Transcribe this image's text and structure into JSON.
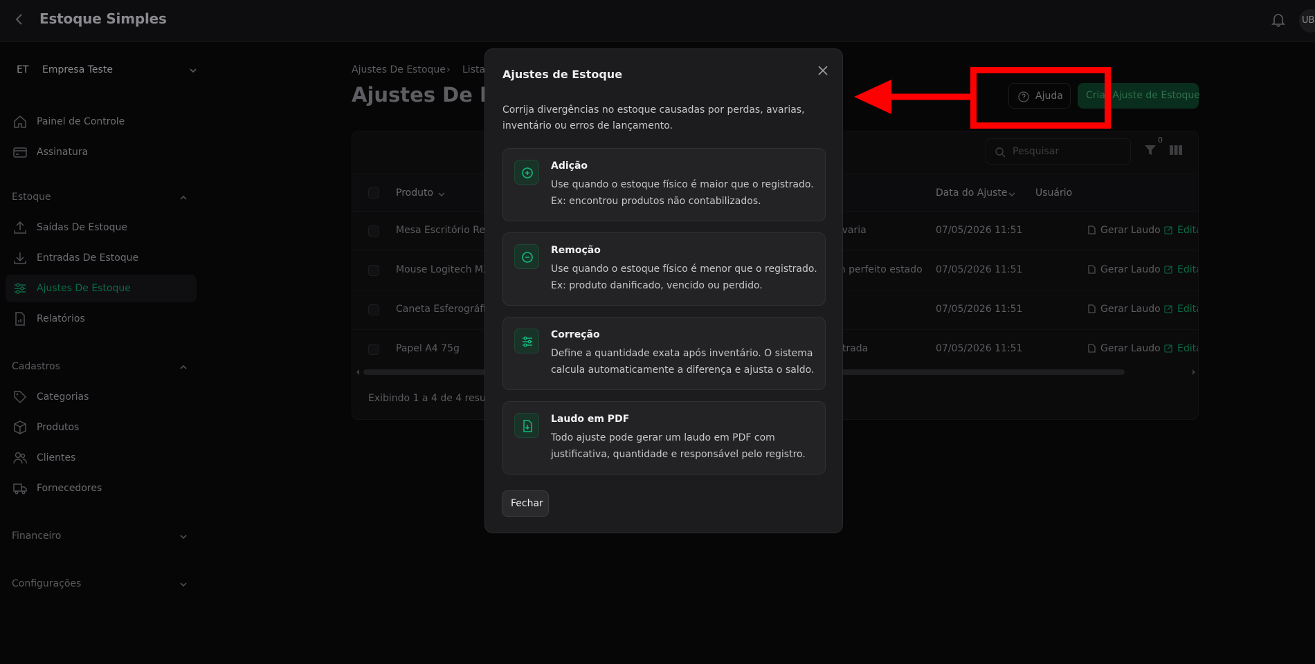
{
  "app": {
    "title": "Estoque Simples",
    "avatar_initials": "UB"
  },
  "sidebar": {
    "company": {
      "abbr": "ET",
      "name": "Empresa Teste"
    },
    "top_items": [
      {
        "label": "Painel de Controle",
        "icon": "home-icon"
      },
      {
        "label": "Assinatura",
        "icon": "credit-card-icon"
      }
    ],
    "sections": [
      {
        "title": "Estoque",
        "expanded": true
      },
      {
        "title": "Cadastros",
        "expanded": true
      },
      {
        "title": "Financeiro",
        "expanded": false
      },
      {
        "title": "Configurações",
        "expanded": false
      }
    ],
    "estoque_items": [
      {
        "label": "Saídas De Estoque",
        "icon": "upload-icon"
      },
      {
        "label": "Entradas De Estoque",
        "icon": "download-icon"
      },
      {
        "label": "Ajustes De Estoque",
        "icon": "sliders-icon",
        "active": true
      },
      {
        "label": "Relatórios",
        "icon": "report-icon"
      }
    ],
    "cadastros_items": [
      {
        "label": "Categorias",
        "icon": "tag-icon"
      },
      {
        "label": "Produtos",
        "icon": "box-icon"
      },
      {
        "label": "Clientes",
        "icon": "users-icon"
      },
      {
        "label": "Fornecedores",
        "icon": "truck-icon"
      }
    ]
  },
  "main": {
    "breadcrumb": [
      "Ajustes De Estoque",
      "Lista"
    ],
    "page_title": "Ajustes De Estoque",
    "help_label": "Ajuda",
    "create_label": "Criar Ajuste de Estoque",
    "search_placeholder": "Pesquisar",
    "filter_count": "0",
    "columns": {
      "produto": "Produto",
      "data": "Data do Ajuste",
      "usuario": "Usuário"
    },
    "rows": [
      {
        "produto": "Mesa Escritório Reta",
        "motivo": "avaria",
        "data": "07/05/2026 11:51"
      },
      {
        "produto": "Mouse Logitech MX",
        "motivo": "m perfeito estado",
        "data": "07/05/2026 11:51"
      },
      {
        "produto": "Caneta Esferográfica",
        "motivo": "",
        "data": "07/05/2026 11:51"
      },
      {
        "produto": "Papel A4 75g",
        "motivo": "ntrada",
        "data": "07/05/2026 11:51"
      }
    ],
    "row_actions": {
      "report": "Gerar Laudo",
      "edit": "Edita"
    },
    "footer": "Exibindo 1 a 4 de 4 resulta"
  },
  "modal": {
    "title": "Ajustes de Estoque",
    "description": "Corrija divergências no estoque causadas por perdas, avarias, inventário ou erros de lançamento.",
    "cards": [
      {
        "title": "Adição",
        "description": "Use quando o estoque físico é maior que o registrado. Ex: encontrou produtos não contabilizados.",
        "icon": "plus-circle-icon"
      },
      {
        "title": "Remoção",
        "description": "Use quando o estoque físico é menor que o registrado. Ex: produto danificado, vencido ou perdido.",
        "icon": "minus-circle-icon"
      },
      {
        "title": "Correção",
        "description": "Define a quantidade exata após inventário. O sistema calcula automaticamente a diferença e ajusta o saldo.",
        "icon": "sliders-icon"
      },
      {
        "title": "Laudo em PDF",
        "description": "Todo ajuste pode gerar um laudo em PDF com justificativa, quantidade e responsável pelo registro.",
        "icon": "file-download-icon"
      }
    ],
    "close_label": "Fechar"
  },
  "colors": {
    "accent": "#10b981",
    "annotation": "#ff0000",
    "modal_bg": "#1c1c1e"
  }
}
